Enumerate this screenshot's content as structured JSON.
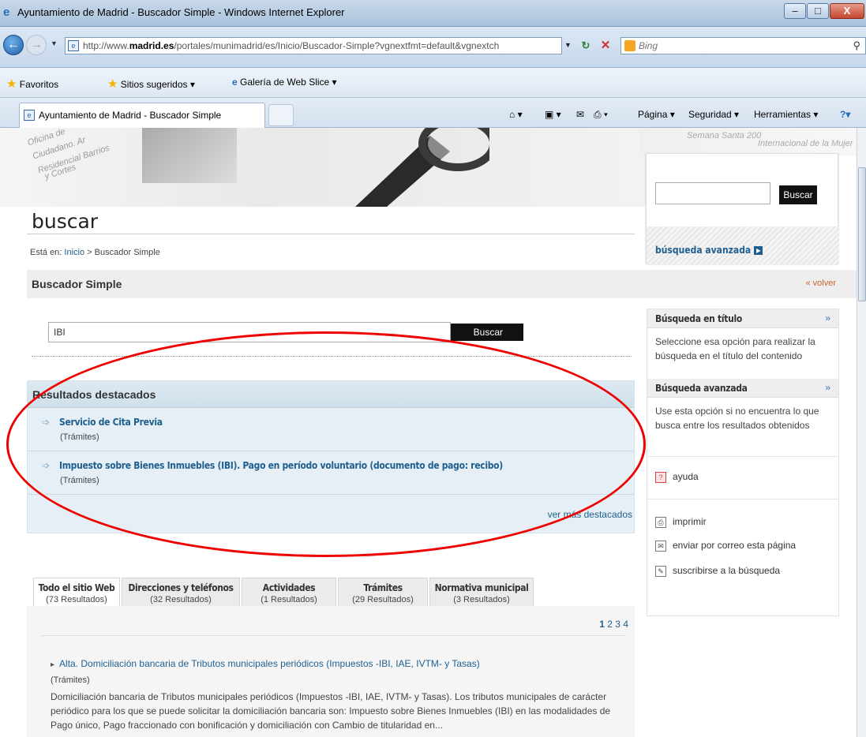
{
  "window": {
    "title": "Ayuntamiento de Madrid - Buscador Simple - Windows Internet Explorer",
    "min": "–",
    "max": "□",
    "close": "X"
  },
  "address": {
    "url_prefix": "http://www.",
    "url_domain": "madrid.es",
    "url_rest": "/portales/munimadrid/es/Inicio/Buscador-Simple?vgnextfmt=default&vgnextch",
    "search_placeholder": "Bing"
  },
  "favorites": {
    "favorites_label": "Favoritos",
    "suggested_label": "Sitios sugeridos",
    "gallery_label": "Galería de Web Slice"
  },
  "tab": {
    "label": "Ayuntamiento de Madrid - Buscador Simple"
  },
  "commands": {
    "page": "Página",
    "security": "Seguridad",
    "tools": "Herramientas"
  },
  "banner": {
    "left_lines": [
      "Oficina de",
      "Ciudadano. Ar",
      "Residencial Barrios",
      "y Cortes"
    ],
    "right_text": "Semana Santa 200",
    "right_text_2": "Internacional de la Mujer"
  },
  "page": {
    "heading": "buscar",
    "breadcrumb_prefix": "Está en:",
    "breadcrumb_link": "Inicio",
    "breadcrumb_current": "Buscador Simple",
    "section_title": "Buscador Simple",
    "back_label": "volver"
  },
  "widget": {
    "button": "Buscar",
    "advanced": "búsqueda avanzada"
  },
  "search": {
    "value": "IBI",
    "button": "Buscar"
  },
  "featured": {
    "title": "Resultados destacados",
    "items": [
      {
        "title": "Servicio de Cita Previa",
        "category": "(Trámites)"
      },
      {
        "title": "Impuesto sobre Bienes Inmuebles (IBI). Pago en período voluntario (documento de pago: recibo)",
        "category": "(Trámites)"
      }
    ],
    "more": "ver más destacados"
  },
  "tabs": [
    {
      "label": "Todo el sitio Web",
      "count": "(73 Resultados)"
    },
    {
      "label": "Direcciones y teléfonos",
      "count": "(32 Resultados)"
    },
    {
      "label": "Actividades",
      "count": "(1 Resultados)"
    },
    {
      "label": "Trámites",
      "count": "(29 Resultados)"
    },
    {
      "label": "Normativa municipal",
      "count": "(3 Resultados)"
    }
  ],
  "pager": {
    "current": "1",
    "pages": "2 3 4"
  },
  "results": [
    {
      "title": "Alta. Domiciliación bancaria de Tributos municipales periódicos (Impuestos -IBI, IAE, IVTM- y Tasas)",
      "category": "(Trámites)",
      "description": "Domiciliación bancaria de Tributos municipales periódicos (Impuestos -IBI, IAE, IVTM- y Tasas). Los tributos municipales de carácter periódico para los que se puede solicitar la domiciliación bancaria son: Impuesto sobre Bienes Inmuebles (IBI) en las modalidades de Pago único, Pago fraccionado con bonificación y domiciliación con Cambio de titularidad en..."
    }
  ],
  "sidebar": {
    "title_search": "Búsqueda en título",
    "title_search_text": "Seleccione esa opción para realizar la búsqueda en el título del contenido",
    "advanced_search": "Búsqueda avanzada",
    "advanced_search_text": "Use esta opción si no encuentra lo que busca entre los resultados obtenidos",
    "help": "ayuda",
    "print": "imprimir",
    "email": "enviar por correo esta página",
    "subscribe": "suscribirse a la búsqueda",
    "arrow": "»"
  },
  "colors": {
    "link": "#1f5f8f",
    "annotation": "#e00000",
    "featured_bg": "#e5eff5"
  }
}
